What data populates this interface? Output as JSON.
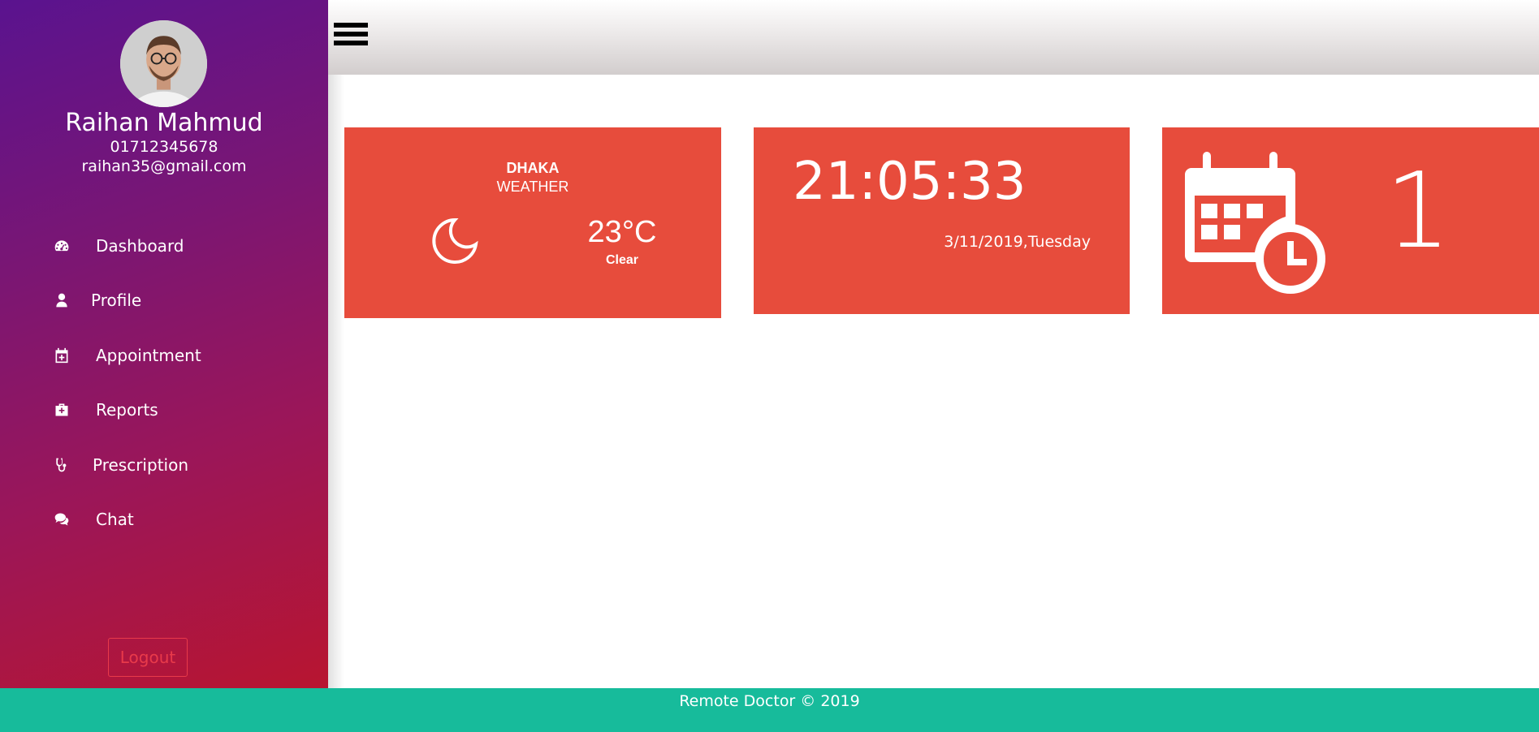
{
  "user": {
    "name": "Raihan Mahmud",
    "phone": "01712345678",
    "email": "raihan35@gmail.com"
  },
  "sidebar": {
    "items": [
      {
        "label": "Dashboard",
        "icon": "dashboard-icon"
      },
      {
        "label": "Profile",
        "icon": "user-icon"
      },
      {
        "label": "Appointment",
        "icon": "calendar-plus-icon"
      },
      {
        "label": "Reports",
        "icon": "medkit-icon"
      },
      {
        "label": "Prescription",
        "icon": "stethoscope-icon"
      },
      {
        "label": "Chat",
        "icon": "comments-icon"
      }
    ],
    "logout_label": "Logout"
  },
  "weather": {
    "city": "DHAKA",
    "label": "WEATHER",
    "temperature": "23°C",
    "condition": "Clear",
    "icon": "moon-icon"
  },
  "clock": {
    "time": "21:05:33",
    "date": "3/11/2019,Tuesday"
  },
  "appointments": {
    "count": "1",
    "icon": "calendar-clock-icon"
  },
  "footer": {
    "text": "Remote Doctor © 2019"
  },
  "colors": {
    "card": "#e74c3c",
    "footer": "#17bb9b",
    "logout": "#e83a4a",
    "sidebar_top": "#5a138f",
    "sidebar_bottom": "#b81530"
  }
}
